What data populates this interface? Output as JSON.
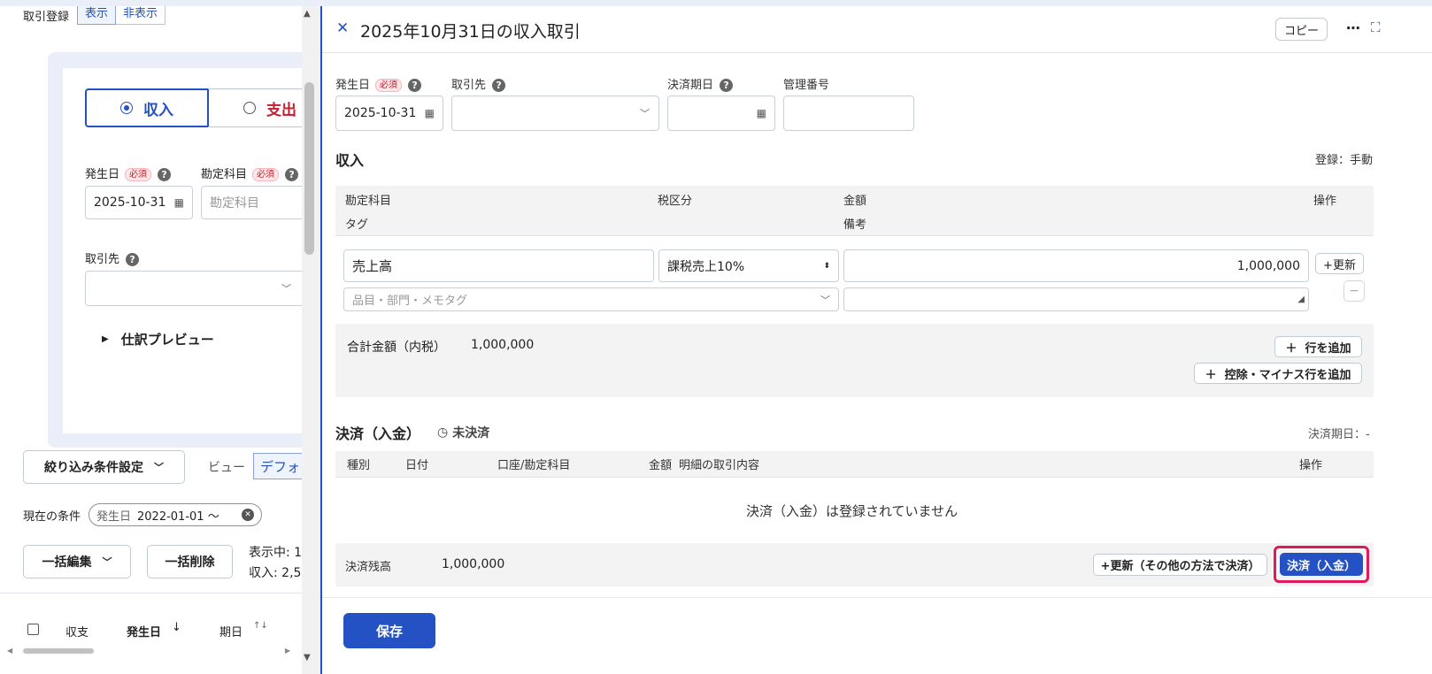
{
  "left": {
    "torihiki_label": "取引登録",
    "show_label": "表示",
    "hide_label": "非表示",
    "income_label": "収入",
    "expense_label": "支出",
    "date_label": "発生日",
    "required": "必須",
    "account_label": "勘定科目",
    "date_value": "2025-10-31",
    "account_placeholder": "勘定科目",
    "partner_label": "取引先",
    "preview_label": "仕訳プレビュー",
    "filter_button": "絞り込み条件設定",
    "view_label": "ビュー",
    "view_value": "デフォ",
    "condition_label": "現在の条件",
    "condition_key": "発生日",
    "condition_value": "2022-01-01 〜",
    "bulk_edit": "一括編集",
    "bulk_delete": "一括削除",
    "showing": "表示中: 1",
    "income_total": "収入: 2,5",
    "col_type": "収支",
    "col_date": "発生日",
    "col_due": "期日"
  },
  "panel": {
    "title": "2025年10月31日の収入取引",
    "copy": "コピー",
    "date_label": "発生日",
    "required": "必須",
    "partner_label": "取引先",
    "due_label": "決済期日",
    "mgmt_label": "管理番号",
    "date_value": "2025-10-31",
    "income_section": "収入",
    "registration": "登録：手動",
    "col_account": "勘定科目",
    "col_tax": "税区分",
    "col_amount": "金額",
    "col_action": "操作",
    "col_tag": "タグ",
    "col_note": "備考",
    "row_account": "売上高",
    "row_tax": "課税売上10%",
    "row_amount": "1,000,000",
    "update_button": "+更新",
    "tag_placeholder": "品目・部門・メモタグ",
    "total_label": "合計金額（内税）",
    "total_value": "1,000,000",
    "add_row": "行を追加",
    "add_deduction": "控除・マイナス行を追加",
    "settlement_title": "決済（入金）",
    "unsettled": "未決済",
    "due_text": "決済期日：-",
    "s_col_type": "種別",
    "s_col_date": "日付",
    "s_col_account": "口座/勘定科目",
    "s_col_amount": "金額",
    "s_col_detail": "明細の取引内容",
    "s_col_action": "操作",
    "empty_message": "決済（入金）は登録されていません",
    "balance_label": "決済残高",
    "balance_value": "1,000,000",
    "update_other": "+更新（その他の方法で決済）",
    "settle_button": "決済（入金）",
    "save_button": "保存"
  },
  "colors": {
    "accent": "#2452c4",
    "expense_red": "#c3202f",
    "highlight": "#e0195a"
  }
}
